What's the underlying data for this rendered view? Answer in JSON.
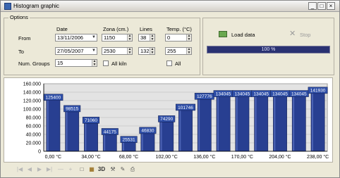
{
  "window": {
    "title": "Histogram graphic",
    "min_label": "_",
    "max_label": "□",
    "close_label": "×"
  },
  "options": {
    "group_label": "Options",
    "row_from": "From",
    "row_to": "To",
    "row_num_groups": "Num. Groups",
    "col_date": "Date",
    "col_zona": "Zona (cm.)",
    "col_lines": "Lines",
    "col_temp": "Temp. (°C)",
    "from_date": "13/11/2006",
    "to_date": "27/05/2007",
    "from_zona": "1150",
    "to_zona": "2530",
    "from_lines": "38",
    "to_lines": "132",
    "from_temp": "0",
    "to_temp": "255",
    "num_groups": "15",
    "all_kiln_label": "All kiln",
    "all_label": "All"
  },
  "actions": {
    "load_label": "Load data",
    "stop_label": "Stop",
    "progress_percent": 100,
    "progress_text": "100 %"
  },
  "colors": {
    "bar": "#283f91",
    "bar_highlight": "#5b74c4",
    "label_bg": "#2f4fa8",
    "panel_bg": "#e3e3e3"
  },
  "chart_data": {
    "type": "bar",
    "values": [
      125400,
      98515,
      71060,
      44175,
      25531,
      46830,
      74290,
      101746,
      127776,
      134045,
      134045,
      134045,
      134045,
      134045,
      141930
    ],
    "labels": [
      "125400",
      "98515",
      "71060",
      "44175",
      "25531",
      "46830",
      "74290",
      "101746",
      "127776",
      "134045",
      "134045",
      "134045",
      "134045",
      "134045",
      "141930"
    ],
    "y_ticks": [
      "0",
      "20.000",
      "40.000",
      "60.000",
      "80.000",
      "100.000",
      "120.000",
      "140.000",
      "160.000"
    ],
    "x_ticks": [
      "0,00 °C",
      "34,00 °C",
      "68,00 °C",
      "102,00 °C",
      "136,00 °C",
      "170,00 °C",
      "204,00 °C",
      "238,00 °C"
    ],
    "ylim": [
      0,
      160000
    ],
    "grid": true
  },
  "toolbar": {
    "icons": [
      "first-icon",
      "previous-icon",
      "next-icon",
      "last-icon",
      "minus-icon",
      "plus-icon",
      "copy-icon",
      "stats-icon",
      "3d-icon",
      "tools-icon",
      "edit-icon",
      "print-icon"
    ]
  }
}
